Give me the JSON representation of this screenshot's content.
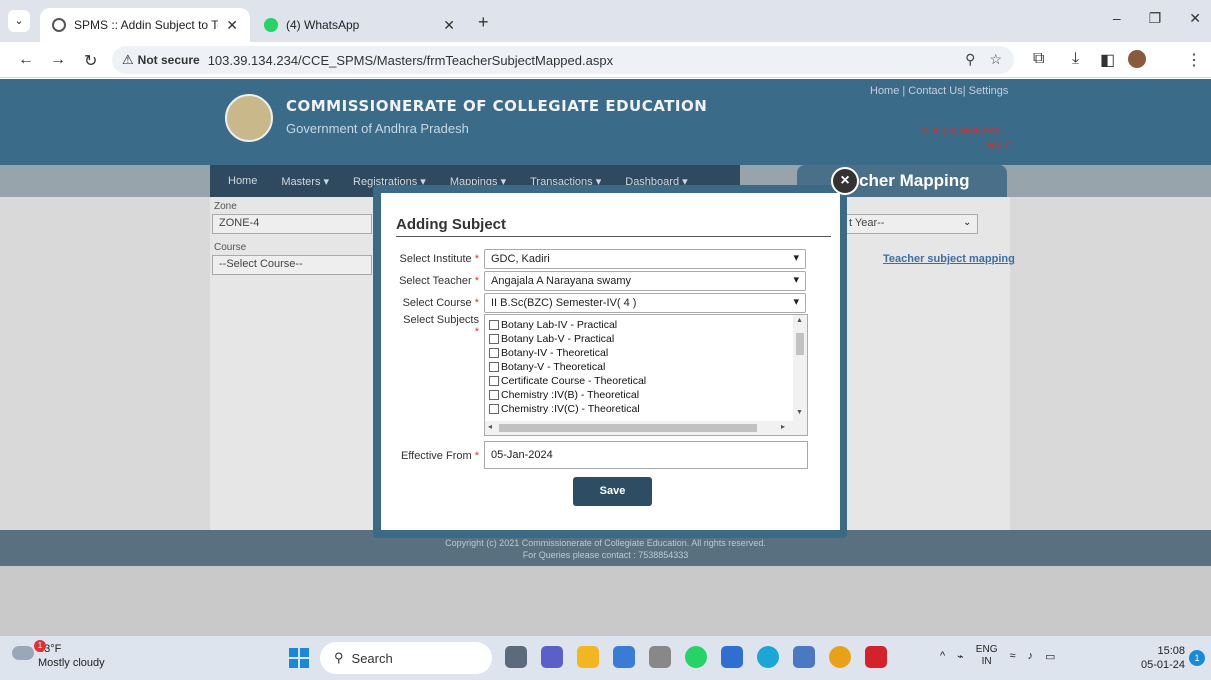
{
  "browser": {
    "tabs": [
      {
        "title": "SPMS :: Addin Subject to Teach",
        "active": true
      },
      {
        "title": "(4) WhatsApp",
        "active": false
      }
    ],
    "not_secure": "Not secure",
    "url": "103.39.134.234/CCE_SPMS/Masters/frmTeacherSubjectMapped.aspx"
  },
  "header": {
    "org_title": "COMMISSIONERATE OF COLLEGIATE EDUCATION",
    "org_subtitle": "Government of Andhra Pradesh",
    "top_links": "Home | Contact Us| Settings",
    "user": "GDC(S) SRIKAKU...",
    "logout": "Logout"
  },
  "menu": [
    "Home",
    "Masters ▾",
    "Registrations ▾",
    "Mappings ▾",
    "Transactions ▾",
    "Dashboard ▾"
  ],
  "page_tab": "cher Mapping",
  "filters": {
    "zone_label": "Zone",
    "zone_value": "ZONE-4",
    "course_label": "Course",
    "course_value": "--Select Course--",
    "year_value": "t Year--",
    "mapping_link": "Teacher subject mapping"
  },
  "footer": {
    "copyright": "Copyright (c) 2021 Commissionerate of Collegiate Education. All rights reserved.",
    "contact": "For Queries please contact : 7538854333"
  },
  "modal": {
    "title": "Adding Subject",
    "close": "×",
    "institute_label": "Select Institute",
    "institute_value": "GDC, Kadiri",
    "teacher_label": "Select Teacher",
    "teacher_value": "Angajala A Narayana swamy",
    "course_label": "Select Course",
    "course_value": "II B.Sc(BZC) Semester-IV( 4 )",
    "subjects_label": "Select Subjects",
    "subjects": [
      "Botany Lab-IV - Practical",
      "Botany Lab-V - Practical",
      "Botany-IV - Theoretical",
      "Botany-V - Theoretical",
      "Certificate Course - Theoretical",
      "Chemistry :IV(B) - Theoretical",
      "Chemistry :IV(C) - Theoretical"
    ],
    "effective_label": "Effective From",
    "effective_value": "05-Jan-2024",
    "save": "Save"
  },
  "taskbar": {
    "temp": "83°F",
    "weather": "Mostly cloudy",
    "weather_badge": "1",
    "search": "Search",
    "lang1": "ENG",
    "lang2": "IN",
    "time": "15:08",
    "date": "05-01-24",
    "notif": "1"
  }
}
